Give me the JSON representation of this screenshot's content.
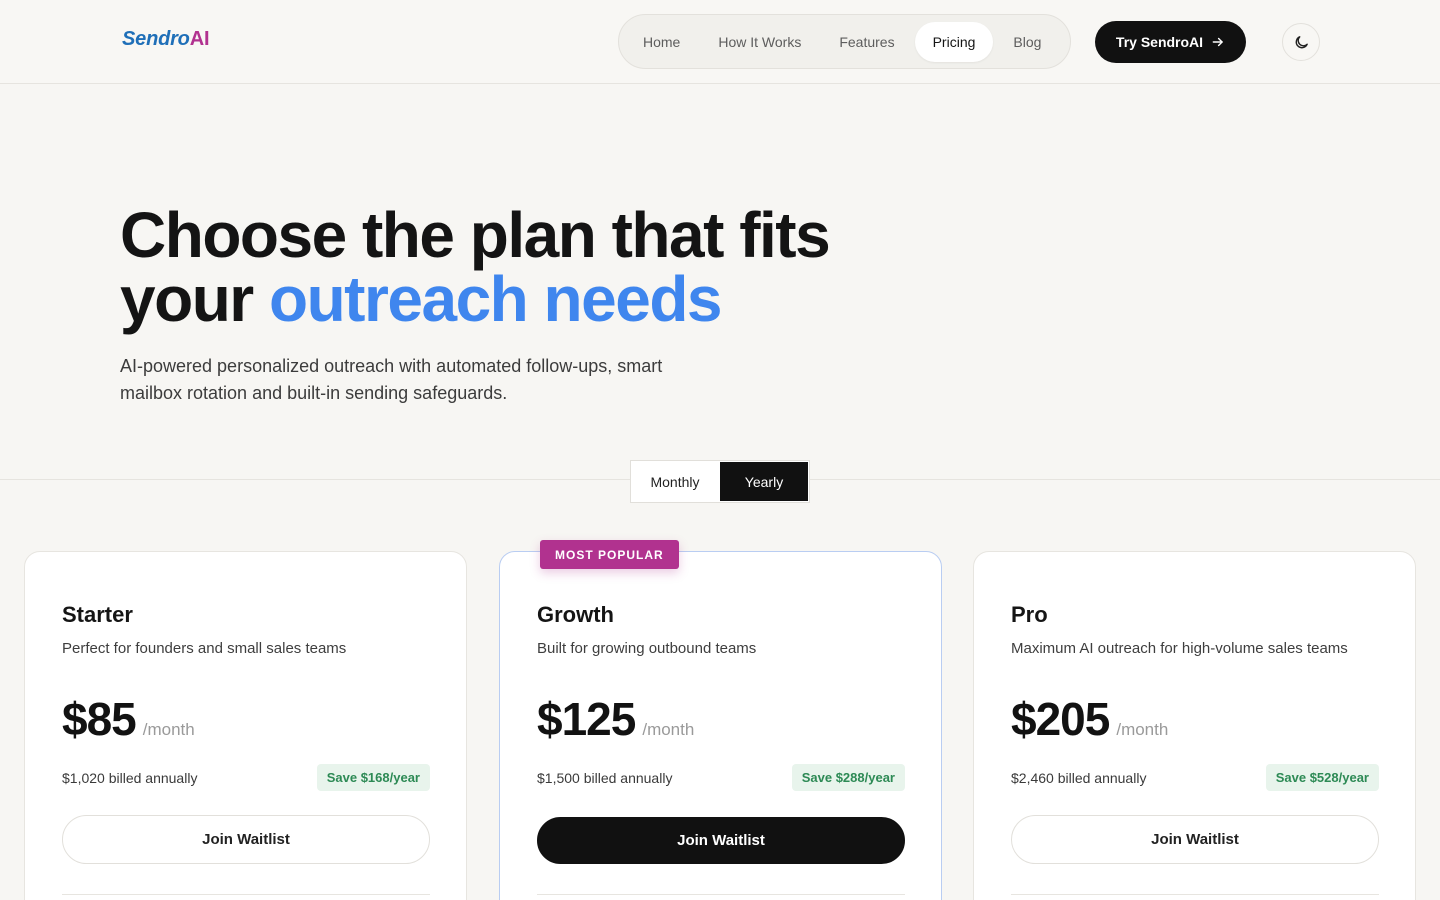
{
  "brand": {
    "part1": "Sendro",
    "part2": "AI"
  },
  "nav": {
    "items": [
      {
        "label": "Home",
        "active": false
      },
      {
        "label": "How It Works",
        "active": false
      },
      {
        "label": "Features",
        "active": false
      },
      {
        "label": "Pricing",
        "active": true
      },
      {
        "label": "Blog",
        "active": false
      }
    ],
    "cta_label": "Try SendroAI",
    "theme_icon": "moon-icon"
  },
  "hero": {
    "title_line1": "Choose the plan that fits",
    "title_line2_prefix": "your ",
    "title_line2_accent": "outreach needs",
    "subtitle": "AI-powered personalized outreach with automated follow-ups, smart mailbox rotation and built-in sending safeguards."
  },
  "billing_toggle": {
    "options": [
      "Monthly",
      "Yearly"
    ],
    "selected": "Yearly"
  },
  "plans": [
    {
      "name": "Starter",
      "description": "Perfect for founders and small sales teams",
      "price": "$85",
      "period": "/month",
      "billed": "$1,020 billed annually",
      "save": "Save $168/year",
      "button": "Join Waitlist",
      "popular": false
    },
    {
      "name": "Growth",
      "description": "Built for growing outbound teams",
      "price": "$125",
      "period": "/month",
      "billed": "$1,500 billed annually",
      "save": "Save $288/year",
      "button": "Join Waitlist",
      "popular": true,
      "badge": "MOST POPULAR"
    },
    {
      "name": "Pro",
      "description": "Maximum AI outreach for high-volume sales teams",
      "price": "$205",
      "period": "/month",
      "billed": "$2,460 billed annually",
      "save": "Save $528/year",
      "button": "Join Waitlist",
      "popular": false
    }
  ],
  "colors": {
    "brand_blue": "#1f6fb8",
    "brand_magenta": "#b1328f",
    "accent_blue": "#3f86ee",
    "save_green": "#2d8a55",
    "dark": "#111111"
  }
}
